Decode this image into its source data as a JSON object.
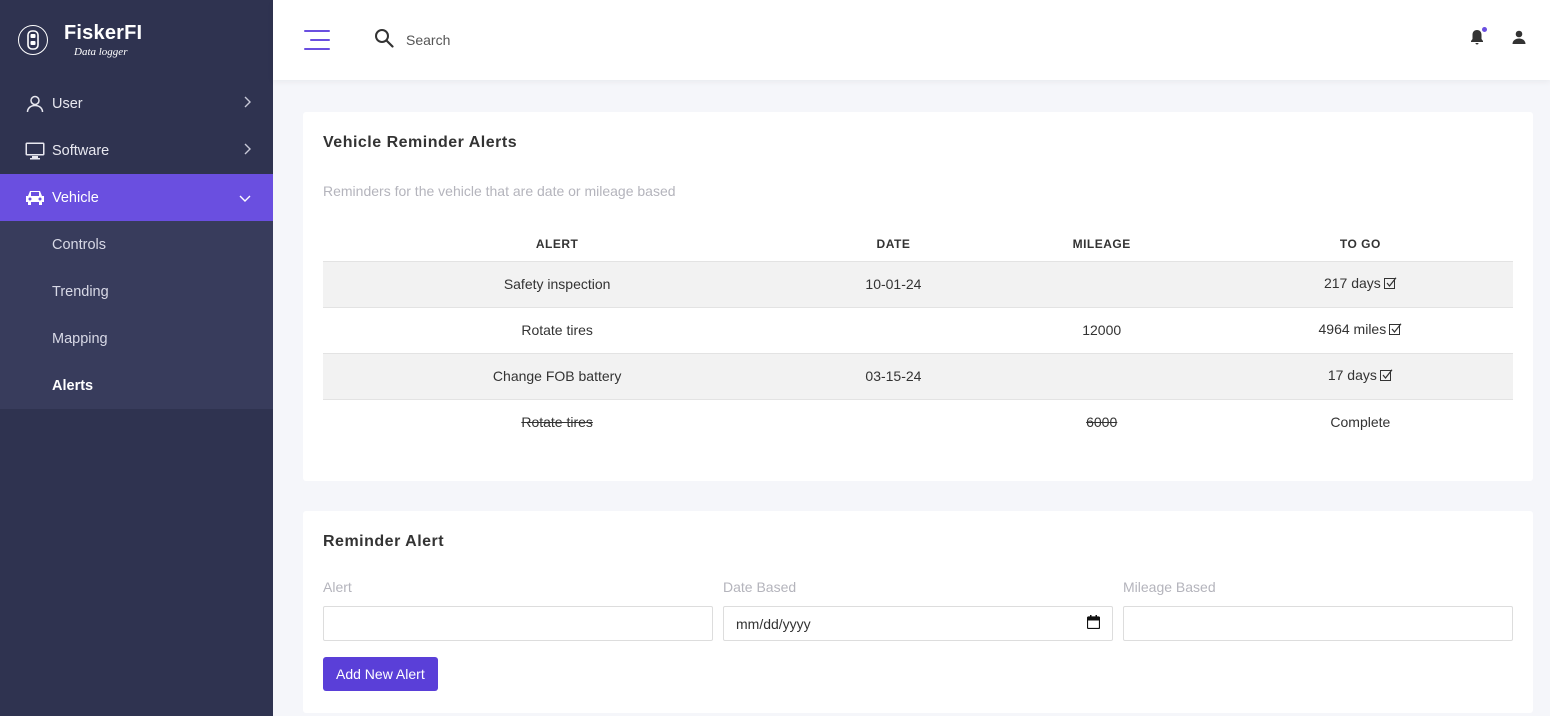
{
  "brand": {
    "name": "FiskerFI",
    "subtitle": "Data logger",
    "logo_icon": "car-key-icon"
  },
  "sidebar": {
    "items": [
      {
        "label": "User",
        "icon": "user-icon"
      },
      {
        "label": "Software",
        "icon": "monitor-icon"
      },
      {
        "label": "Vehicle",
        "icon": "car-icon",
        "active": true
      }
    ],
    "sub_items": [
      {
        "label": "Controls"
      },
      {
        "label": "Trending"
      },
      {
        "label": "Mapping"
      },
      {
        "label": "Alerts",
        "active": true
      }
    ]
  },
  "topbar": {
    "search_placeholder": "Search"
  },
  "alerts_card": {
    "title": "Vehicle Reminder Alerts",
    "description": "Reminders for the vehicle that are date or mileage based",
    "columns": [
      "ALERT",
      "DATE",
      "MILEAGE",
      "TO GO"
    ],
    "rows": [
      {
        "alert": "Safety inspection",
        "date": "10-01-24",
        "mileage": "",
        "to_go": "217 days",
        "checked": true,
        "completed": false
      },
      {
        "alert": "Rotate tires",
        "date": "",
        "mileage": "12000",
        "to_go": "4964 miles",
        "checked": true,
        "completed": false
      },
      {
        "alert": "Change FOB battery",
        "date": "03-15-24",
        "mileage": "",
        "to_go": "17 days",
        "checked": true,
        "completed": false
      },
      {
        "alert": "Rotate tires",
        "date": "",
        "mileage": "6000",
        "to_go": "Complete",
        "checked": false,
        "completed": true
      }
    ]
  },
  "form_card": {
    "title": "Reminder Alert",
    "alert_label": "Alert",
    "alert_value": "",
    "date_label": "Date Based",
    "date_placeholder": "mm/dd/yyyy",
    "mileage_label": "Mileage Based",
    "mileage_value": "",
    "submit_label": "Add New Alert"
  },
  "colors": {
    "sidebar_bg": "#2f3350",
    "accent": "#6a4fe0",
    "button": "#5a3fd8"
  }
}
